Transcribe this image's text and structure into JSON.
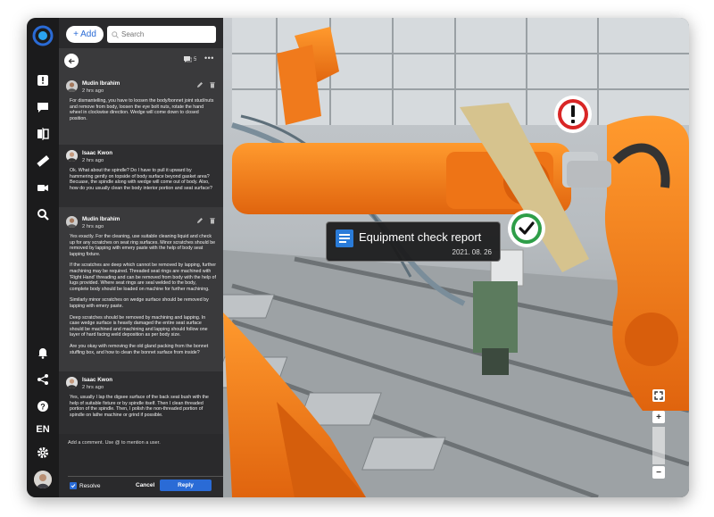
{
  "toolbar": {
    "add_label": "+ Add",
    "search_placeholder": "Search"
  },
  "thread": {
    "comment_count": "5"
  },
  "comments": [
    {
      "author": "Mudin Ibrahim",
      "time": "2 hrs ago",
      "paragraphs": [
        "For dismantelling, you have to loosen the body/bonnet joint stud/nuts and remove from body, loosen the eye bolt nuts, rotate the hand wheel in clockwise direction. Wedge will come down to closed position."
      ]
    },
    {
      "author": "Isaac Kwon",
      "time": "2 hrs ago",
      "paragraphs": [
        "Ok. What about the spindle? Do I have to pull it upward by hammering gently on topside of body surface beyond gasket area? Becuase, the spindle along with wedge will come out of body. Also, how do you usually clean the body interior portion and seat surface?"
      ]
    },
    {
      "author": "Mudin Ibrahim",
      "time": "2 hrs ago",
      "paragraphs": [
        "Yes exactly. For the cleaning, use suitable cleaning liquid and check up for any scratches on seat ring surfaces. Minor scratches should be removed by lapping with emery paste with the help of body seat lapping fixture.",
        "If the scratches are deep which cannot be removed by lapping, further machining may be required. Threaded seat rings are machined with 'Right Hand' threading and can be removed from body with the help of lugs provided. Where seat rings are seal welded to the body, complete body should be loaded on machine for further machining.",
        "Similarly minor scratches on wedge surface should be removed by lapping with emery paste.",
        "Deep scratches should be removed by machining and lapping. In case wedge surface is heavily damaged the entire seat surface should be machined and machining and lapping should follow one layer of hard facing weld deposition as per body size.",
        "Are you okay with removing the old gland packing from the bonnet stuffing box, and how to clean the bonnet surface from inside?"
      ]
    },
    {
      "author": "Isaac Kwon",
      "time": "2 hrs ago",
      "paragraphs": [
        "Yes, usually I lap the digsee surface of the back seat bush with the help of suitable fixture or by spindle itself. Then I clean threaded portion of the spindle. Then, I polish the non-threaded portion of spindle on lathe machine or grind if possible."
      ]
    }
  ],
  "composer": {
    "placeholder": "Add a comment. Use @ to mention a user.",
    "resolve_label": "Resolve",
    "cancel_label": "Cancel",
    "reply_label": "Reply"
  },
  "sidebar": {
    "language": "EN"
  },
  "callout": {
    "title": "Equipment check report",
    "date": "2021. 08. 26"
  },
  "map_controls": {
    "zoom_in": "+",
    "zoom_out": "−"
  },
  "colors": {
    "accent": "#2a6bd6",
    "alert": "#d92626",
    "ok": "#2e9e48",
    "panel": "#3a3a3c"
  }
}
